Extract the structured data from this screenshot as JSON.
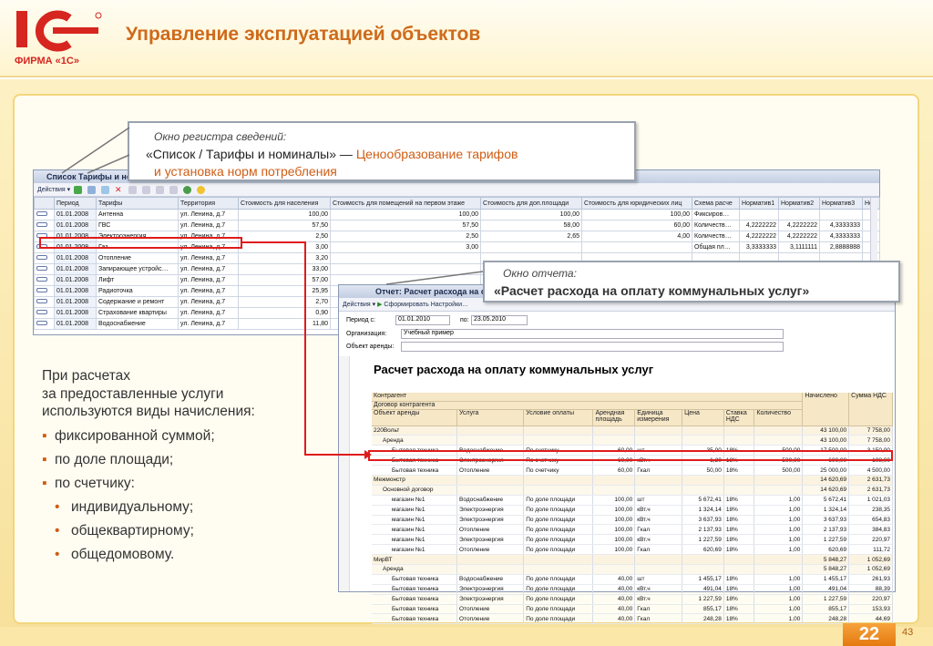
{
  "header": {
    "title": "Управление эксплуатацией объектов",
    "logo_text": "1С",
    "logo_sub": "ФИРМА «1С»"
  },
  "callout1": {
    "caption": "Окно регистра сведений:",
    "line1_quote": "«Список / Тарифы и номиналы»",
    "line1_dash": "—",
    "line1_rest": "Ценообразование тарифов",
    "line2": "и установка норм потребления"
  },
  "callout2": {
    "caption": "Окно отчета:",
    "text": "«Расчет расхода на оплату коммунальных услуг»"
  },
  "win1": {
    "title": "Список Тарифы и номин",
    "toolbar": {
      "actions": "Действия"
    },
    "columns": [
      "Период",
      "Тарифы",
      "Территория",
      "Стоимость для населения",
      "Стоимость для помещений на первом этаже",
      "Стоимость для доп.площади",
      "Стоимость для юридических лиц",
      "Схема расче",
      "Норматив1",
      "Норматив2",
      "Норматив3",
      "Но"
    ],
    "rows": [
      [
        "01.01.2008",
        "Антенна",
        "ул. Ленина, д.7",
        "100,00",
        "100,00",
        "100,00",
        "100,00",
        "Фиксиров…",
        "",
        "",
        "",
        ""
      ],
      [
        "01.01.2008",
        "ГВС",
        "ул. Ленина, д.7",
        "57,50",
        "57,50",
        "58,00",
        "60,00",
        "Количеств…",
        "4,2222222",
        "4,2222222",
        "4,3333333",
        "4"
      ],
      [
        "01.01.2008",
        "Электроэнергия",
        "ул. Ленина, д.7",
        "2,50",
        "2,50",
        "2,65",
        "4,00",
        "Количеств…",
        "4,2222222",
        "4,2222222",
        "4,3333333",
        "4"
      ],
      [
        "01.01.2008",
        "Газ",
        "ул. Ленина, д.7",
        "3,00",
        "3,00",
        "",
        "",
        "Общая пл…",
        "3,3333333",
        "3,1111111",
        "2,8888888",
        "4"
      ],
      [
        "01.01.2008",
        "Отопление",
        "ул. Ленина, д.7",
        "3,20",
        "",
        "",
        "",
        "",
        "",
        "",
        "",
        ""
      ],
      [
        "01.01.2008",
        "Запирающее устройс…",
        "ул. Ленина, д.7",
        "33,00",
        "",
        "",
        "",
        "",
        "",
        "",
        "",
        ""
      ],
      [
        "01.01.2008",
        "Лифт",
        "ул. Ленина, д.7",
        "57,00",
        "",
        "",
        "",
        "",
        "",
        "",
        "",
        ""
      ],
      [
        "01.01.2008",
        "Радиоточка",
        "ул. Ленина, д.7",
        "25,95",
        "",
        "",
        "",
        "",
        "",
        "",
        "",
        ""
      ],
      [
        "01.01.2008",
        "Содержание и ремонт",
        "ул. Ленина, д.7",
        "2,70",
        "",
        "",
        "",
        "",
        "",
        "",
        "",
        ""
      ],
      [
        "01.01.2008",
        "Страхование квартиры",
        "ул. Ленина, д.7",
        "0,90",
        "",
        "",
        "",
        "",
        "",
        "",
        "",
        ""
      ],
      [
        "01.01.2008",
        "Водоснабжение",
        "ул. Ленина, д.7",
        "11,80",
        "",
        "",
        "",
        "",
        "",
        "",
        "",
        ""
      ]
    ]
  },
  "win2": {
    "title": "Отчет: Расчет расхода на оплату к",
    "toolbar": {
      "actions": "Действия",
      "generate": "Сформировать",
      "settings": "Настройки…"
    },
    "period_label": "Период с:",
    "period_from": "01.01.2010",
    "period_to_label": "по:",
    "period_to": "23.05.2010",
    "org_label": "Организация:",
    "org_value": "Учебный пример",
    "obj_label": "Объект аренды:",
    "report_title": "Расчет расхода на оплату коммунальных услуг",
    "head": {
      "h1": "Контрагент",
      "h2": "Договор контрагента",
      "c1": "Объект аренды",
      "c2": "Услуга",
      "c3": "Условие оплаты",
      "c4": "Арендная площадь",
      "c5": "Единица измерения",
      "c6": "Цена",
      "c7": "Ставка НДС",
      "c8": "Количество",
      "c9": "Начислено",
      "c10": "Сумма НДС"
    },
    "rows": [
      {
        "l": 0,
        "c": [
          "220Вольт",
          "",
          "",
          "",
          "",
          "",
          "",
          "",
          "43 100,00",
          "7 758,00"
        ]
      },
      {
        "l": 1,
        "c": [
          "Аренда",
          "",
          "",
          "",
          "",
          "",
          "",
          "",
          "43 100,00",
          "7 758,00"
        ]
      },
      {
        "l": 2,
        "c": [
          "Бытовая техника",
          "Водоснабжение",
          "По счетчику",
          "60,00",
          "шт",
          "35,00",
          "18%",
          "500,00",
          "17 500,00",
          "3 150,00"
        ]
      },
      {
        "l": 2,
        "c": [
          "Бытовая техника",
          "Электроэнергия",
          "По счетчику",
          "60,00",
          "кВт.ч",
          "1,20",
          "18%",
          "500,00",
          "600,00",
          "108,00"
        ]
      },
      {
        "l": 2,
        "c": [
          "Бытовая техника",
          "Отопление",
          "По счетчику",
          "60,00",
          "Гкал",
          "50,00",
          "18%",
          "500,00",
          "25 000,00",
          "4 500,00"
        ]
      },
      {
        "l": 0,
        "c": [
          "Межмонстр",
          "",
          "",
          "",
          "",
          "",
          "",
          "",
          "14 620,69",
          "2 631,73"
        ]
      },
      {
        "l": 1,
        "c": [
          "Основной договор",
          "",
          "",
          "",
          "",
          "",
          "",
          "",
          "14 620,69",
          "2 631,73"
        ]
      },
      {
        "l": 2,
        "c": [
          "магазин №1",
          "Водоснабжение",
          "По доле площади",
          "100,00",
          "шт",
          "5 672,41",
          "18%",
          "1,00",
          "5 672,41",
          "1 021,03"
        ]
      },
      {
        "l": 2,
        "c": [
          "магазин №1",
          "Электроэнергия",
          "По доле площади",
          "100,00",
          "кВт.ч",
          "1 324,14",
          "18%",
          "1,00",
          "1 324,14",
          "238,35"
        ]
      },
      {
        "l": 2,
        "c": [
          "магазин №1",
          "Электроэнергия",
          "По доле площади",
          "100,00",
          "кВт.ч",
          "3 637,93",
          "18%",
          "1,00",
          "3 637,93",
          "654,83"
        ]
      },
      {
        "l": 2,
        "c": [
          "магазин №1",
          "Отопление",
          "По доле площади",
          "100,00",
          "Гкал",
          "2 137,93",
          "18%",
          "1,00",
          "2 137,93",
          "384,83"
        ]
      },
      {
        "l": 2,
        "c": [
          "магазин №1",
          "Электроэнергия",
          "По доле площади",
          "100,00",
          "кВт.ч",
          "1 227,59",
          "18%",
          "1,00",
          "1 227,59",
          "220,97"
        ]
      },
      {
        "l": 2,
        "c": [
          "магазин №1",
          "Отопление",
          "По доле площади",
          "100,00",
          "Гкал",
          "620,69",
          "18%",
          "1,00",
          "620,69",
          "111,72"
        ]
      },
      {
        "l": 0,
        "c": [
          "МирВТ",
          "",
          "",
          "",
          "",
          "",
          "",
          "",
          "5 848,27",
          "1 052,69"
        ]
      },
      {
        "l": 1,
        "c": [
          "Аренда",
          "",
          "",
          "",
          "",
          "",
          "",
          "",
          "5 848,27",
          "1 052,69"
        ]
      },
      {
        "l": 2,
        "c": [
          "Бытовая техника",
          "Водоснабжение",
          "По доле площади",
          "40,00",
          "шт",
          "1 455,17",
          "18%",
          "1,00",
          "1 455,17",
          "261,93"
        ]
      },
      {
        "l": 2,
        "c": [
          "Бытовая техника",
          "Электроэнергия",
          "По доле площади",
          "40,00",
          "кВт.ч",
          "491,04",
          "18%",
          "1,00",
          "491,04",
          "88,39"
        ]
      },
      {
        "l": 2,
        "c": [
          "Бытовая техника",
          "Электроэнергия",
          "По доле площади",
          "40,00",
          "кВт.ч",
          "1 227,59",
          "18%",
          "1,00",
          "1 227,59",
          "220,97"
        ]
      },
      {
        "l": 2,
        "c": [
          "Бытовая техника",
          "Отопление",
          "По доле площади",
          "40,00",
          "Гкал",
          "855,17",
          "18%",
          "1,00",
          "855,17",
          "153,93"
        ]
      },
      {
        "l": 2,
        "c": [
          "Бытовая техника",
          "Отопление",
          "По доле площади",
          "40,00",
          "Гкал",
          "248,28",
          "18%",
          "1,00",
          "248,28",
          "44,69"
        ]
      }
    ]
  },
  "bullets": {
    "intro1": "При расчетах",
    "intro2": "за предоставленные услуги",
    "intro3": "используются виды начисления:",
    "b1": "фиксированной суммой;",
    "b2": "по доле площади;",
    "b3": "по счетчику:",
    "s1": "индивидуальному;",
    "s2": "общеквартирному;",
    "s3": "общедомовому."
  },
  "footer": {
    "page": "22",
    "total": "43"
  },
  "colors": {
    "accent": "#cf6a1a",
    "highlight": "#e01b1b"
  }
}
